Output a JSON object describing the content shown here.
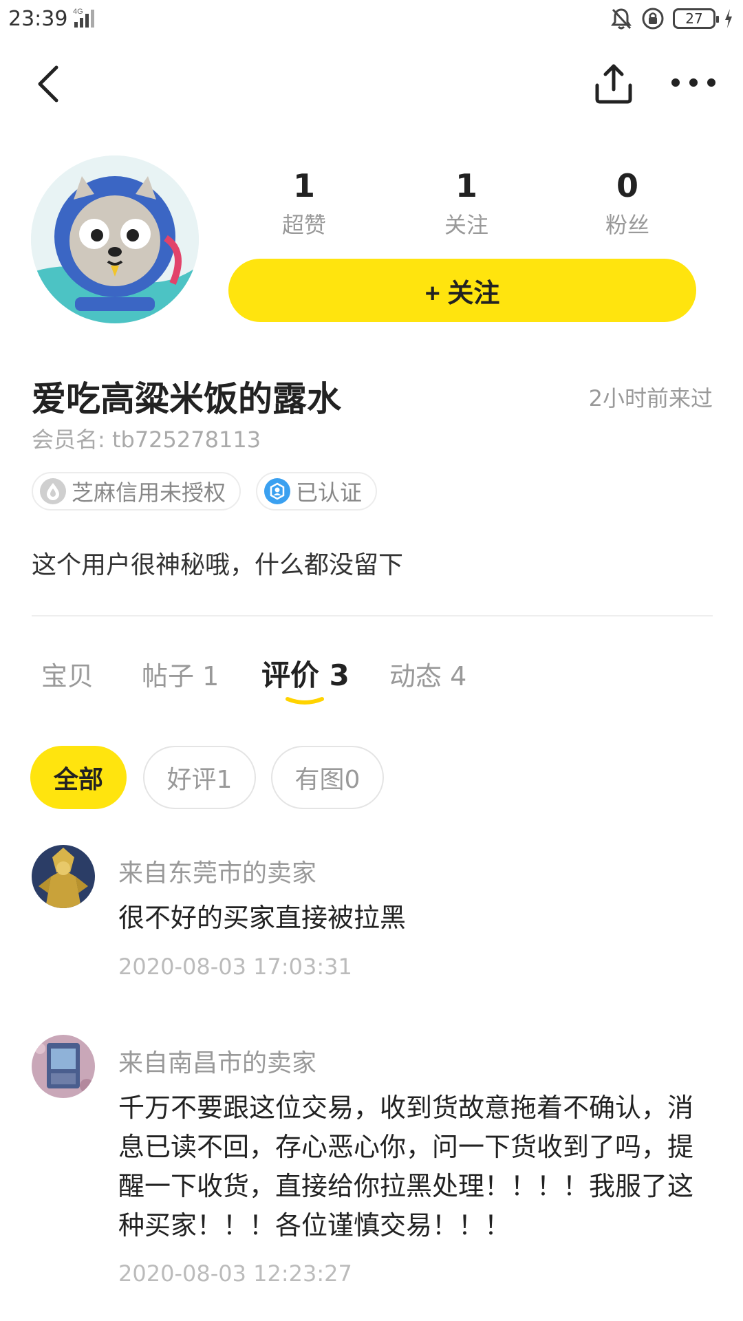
{
  "status_bar": {
    "time": "23:39",
    "network": "4G",
    "battery": "27"
  },
  "nav": {
    "back_icon": "back-arrow-icon",
    "share_icon": "share-icon",
    "more_icon": "more-dots-icon"
  },
  "profile": {
    "stats": [
      {
        "value": "1",
        "label": "超赞"
      },
      {
        "value": "1",
        "label": "关注"
      },
      {
        "value": "0",
        "label": "粉丝"
      }
    ],
    "follow_button": "+ 关注",
    "username": "爱吃高粱米饭的露水",
    "last_seen": "2小时前来过",
    "member_name": "会员名: tb725278113",
    "badges": [
      {
        "label": "芝麻信用未授权",
        "icon": "sesame-credit-icon"
      },
      {
        "label": "已认证",
        "icon": "verified-icon"
      }
    ],
    "bio": "这个用户很神秘哦，什么都没留下"
  },
  "tabs": [
    {
      "label": "宝贝"
    },
    {
      "label": "帖子 1"
    },
    {
      "label": "评价 3"
    },
    {
      "label": "动态 4"
    }
  ],
  "active_tab": "评价 3",
  "filters": [
    {
      "label": "全部"
    },
    {
      "label": "好评1"
    },
    {
      "label": "有图0"
    }
  ],
  "reviews": [
    {
      "from": "来自东莞市的卖家",
      "text": "很不好的买家直接被拉黑",
      "date": "2020-08-03 17:03:31"
    },
    {
      "from": "来自南昌市的卖家",
      "text": "千万不要跟这位交易，收到货故意拖着不确认，消息已读不回，存心恶心你，问一下货收到了吗，提醒一下收货，直接给你拉黑处理！！！！我服了这种买家！！！各位谨慎交易！！！",
      "date": "2020-08-03 12:23:27"
    }
  ],
  "colors": {
    "accent_yellow": "#ffe40e",
    "muted_text": "#999999",
    "verified_blue": "#3aa0f0"
  }
}
